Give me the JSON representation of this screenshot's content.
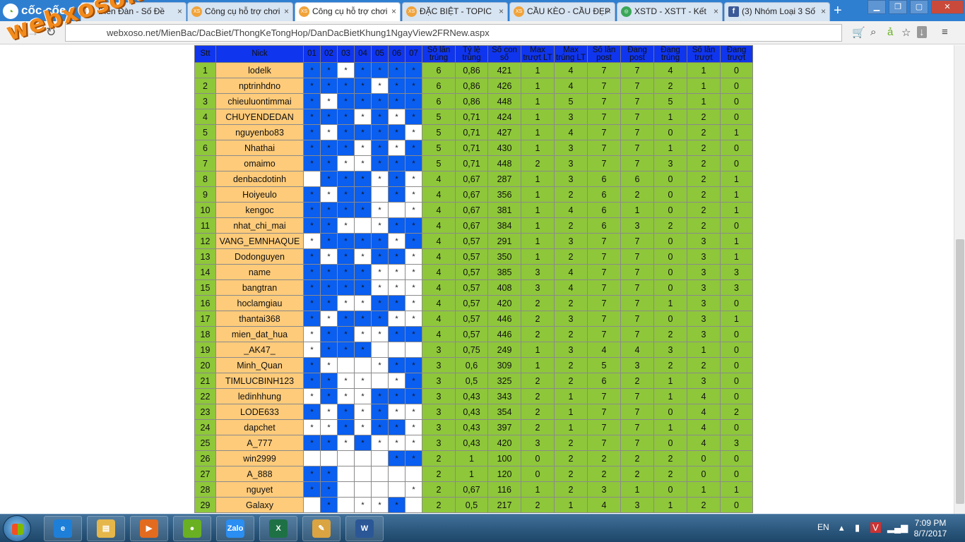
{
  "browser": {
    "brand": "cốc cốc",
    "tabs": [
      {
        "title": "Diễn Đàn - Số Đề",
        "active": false,
        "icon": "page-icon"
      },
      {
        "title": "Công cụ hỗ trợ chơi",
        "active": false,
        "icon": "xs-icon"
      },
      {
        "title": "Công cụ hỗ trợ chơi",
        "active": true,
        "icon": "xs-icon"
      },
      {
        "title": "ĐẶC BIỆT - TOPIC",
        "active": false,
        "icon": "xs-icon"
      },
      {
        "title": "CẦU KÈO - CẦU ĐẸP",
        "active": false,
        "icon": "xs-icon"
      },
      {
        "title": "XSTD - XSTT - Kết",
        "active": false,
        "icon": "chrome-icon"
      },
      {
        "title": "(3) Nhóm Loại 3 Số",
        "active": false,
        "icon": "facebook-icon"
      }
    ],
    "url": "webxoso.net/MienBac/DacBiet/ThongKeTongHop/DanDacBietKhung1NgayView2FRNew.aspx",
    "watermark": "webxoso.net"
  },
  "table": {
    "headers": [
      "Stt",
      "Nick",
      "01",
      "02",
      "03",
      "04",
      "05",
      "06",
      "07",
      "Số lần trúng",
      "Tỷ lệ trúng",
      "Số con số",
      "Max trượt LT",
      "Max trúng LT",
      "Số lần post",
      "Đang post",
      "Đang trúng",
      "Số lần trượt",
      "Đang trượt"
    ],
    "rows": [
      {
        "stt": "1",
        "nick": "lodelk",
        "marks": [
          1,
          1,
          0,
          1,
          1,
          1,
          1
        ],
        "stats": [
          "6",
          "0,86",
          "421",
          "1",
          "4",
          "7",
          "7",
          "4",
          "1",
          "0"
        ]
      },
      {
        "stt": "2",
        "nick": "nptrinhdno",
        "marks": [
          1,
          1,
          1,
          1,
          0,
          1,
          1
        ],
        "stats": [
          "6",
          "0,86",
          "426",
          "1",
          "4",
          "7",
          "7",
          "2",
          "1",
          "0"
        ]
      },
      {
        "stt": "3",
        "nick": "chieuluontimmai",
        "marks": [
          1,
          0,
          1,
          1,
          1,
          1,
          1
        ],
        "stats": [
          "6",
          "0,86",
          "448",
          "1",
          "5",
          "7",
          "7",
          "5",
          "1",
          "0"
        ]
      },
      {
        "stt": "4",
        "nick": "CHUYENDEDAN",
        "marks": [
          1,
          1,
          1,
          0,
          1,
          0,
          1
        ],
        "stats": [
          "5",
          "0,71",
          "424",
          "1",
          "3",
          "7",
          "7",
          "1",
          "2",
          "0"
        ]
      },
      {
        "stt": "5",
        "nick": "nguyenbo83",
        "marks": [
          1,
          0,
          1,
          1,
          1,
          1,
          0
        ],
        "stats": [
          "5",
          "0,71",
          "427",
          "1",
          "4",
          "7",
          "7",
          "0",
          "2",
          "1"
        ]
      },
      {
        "stt": "6",
        "nick": "Nhathai",
        "marks": [
          1,
          1,
          1,
          0,
          1,
          0,
          1
        ],
        "stats": [
          "5",
          "0,71",
          "430",
          "1",
          "3",
          "7",
          "7",
          "1",
          "2",
          "0"
        ]
      },
      {
        "stt": "7",
        "nick": "omaimo",
        "marks": [
          1,
          1,
          0,
          0,
          1,
          1,
          1
        ],
        "stats": [
          "5",
          "0,71",
          "448",
          "2",
          "3",
          "7",
          "7",
          "3",
          "2",
          "0"
        ]
      },
      {
        "stt": "8",
        "nick": "denbacdotinh",
        "marks": [
          -1,
          1,
          1,
          1,
          0,
          1,
          0
        ],
        "stats": [
          "4",
          "0,67",
          "287",
          "1",
          "3",
          "6",
          "6",
          "0",
          "2",
          "1"
        ]
      },
      {
        "stt": "9",
        "nick": "Hoiyeulo",
        "marks": [
          1,
          0,
          1,
          1,
          -1,
          1,
          0
        ],
        "stats": [
          "4",
          "0,67",
          "356",
          "1",
          "2",
          "6",
          "2",
          "0",
          "2",
          "1"
        ]
      },
      {
        "stt": "10",
        "nick": "kengoc",
        "marks": [
          1,
          1,
          1,
          1,
          0,
          -1,
          0
        ],
        "stats": [
          "4",
          "0,67",
          "381",
          "1",
          "4",
          "6",
          "1",
          "0",
          "2",
          "1"
        ]
      },
      {
        "stt": "11",
        "nick": "nhat_chi_mai",
        "marks": [
          1,
          1,
          0,
          -1,
          0,
          1,
          1
        ],
        "stats": [
          "4",
          "0,67",
          "384",
          "1",
          "2",
          "6",
          "3",
          "2",
          "2",
          "0"
        ]
      },
      {
        "stt": "12",
        "nick": "VANG_EMNHAQUE",
        "marks": [
          0,
          1,
          1,
          1,
          1,
          0,
          1
        ],
        "stats": [
          "4",
          "0,57",
          "291",
          "1",
          "3",
          "7",
          "7",
          "0",
          "3",
          "1"
        ]
      },
      {
        "stt": "13",
        "nick": "Dodonguyen",
        "marks": [
          1,
          0,
          1,
          0,
          1,
          1,
          0
        ],
        "stats": [
          "4",
          "0,57",
          "350",
          "1",
          "2",
          "7",
          "7",
          "0",
          "3",
          "1"
        ]
      },
      {
        "stt": "14",
        "nick": "name",
        "marks": [
          1,
          1,
          1,
          1,
          0,
          0,
          0
        ],
        "stats": [
          "4",
          "0,57",
          "385",
          "3",
          "4",
          "7",
          "7",
          "0",
          "3",
          "3"
        ]
      },
      {
        "stt": "15",
        "nick": "bangtran",
        "marks": [
          1,
          1,
          1,
          1,
          0,
          0,
          0
        ],
        "stats": [
          "4",
          "0,57",
          "408",
          "3",
          "4",
          "7",
          "7",
          "0",
          "3",
          "3"
        ]
      },
      {
        "stt": "16",
        "nick": "hoclamgiau",
        "marks": [
          1,
          1,
          0,
          0,
          1,
          1,
          0
        ],
        "stats": [
          "4",
          "0,57",
          "420",
          "2",
          "2",
          "7",
          "7",
          "1",
          "3",
          "0"
        ]
      },
      {
        "stt": "17",
        "nick": "thantai368",
        "marks": [
          1,
          0,
          1,
          1,
          1,
          0,
          0
        ],
        "stats": [
          "4",
          "0,57",
          "446",
          "2",
          "3",
          "7",
          "7",
          "0",
          "3",
          "1"
        ]
      },
      {
        "stt": "18",
        "nick": "mien_dat_hua",
        "marks": [
          0,
          1,
          1,
          0,
          0,
          1,
          1
        ],
        "stats": [
          "4",
          "0,57",
          "446",
          "2",
          "2",
          "7",
          "7",
          "2",
          "3",
          "0"
        ]
      },
      {
        "stt": "19",
        "nick": "_AK47_",
        "marks": [
          0,
          1,
          1,
          1,
          -1,
          -1,
          -1
        ],
        "stats": [
          "3",
          "0,75",
          "249",
          "1",
          "3",
          "4",
          "4",
          "3",
          "1",
          "0"
        ]
      },
      {
        "stt": "20",
        "nick": "Minh_Quan",
        "marks": [
          1,
          0,
          -1,
          -1,
          0,
          1,
          1
        ],
        "stats": [
          "3",
          "0,6",
          "309",
          "1",
          "2",
          "5",
          "3",
          "2",
          "2",
          "0"
        ]
      },
      {
        "stt": "21",
        "nick": "TIMLUCBINH123",
        "marks": [
          1,
          1,
          0,
          0,
          -1,
          0,
          1
        ],
        "stats": [
          "3",
          "0,5",
          "325",
          "2",
          "2",
          "6",
          "2",
          "1",
          "3",
          "0"
        ]
      },
      {
        "stt": "22",
        "nick": "ledinhhung",
        "marks": [
          0,
          1,
          0,
          0,
          1,
          1,
          1
        ],
        "stats": [
          "3",
          "0,43",
          "343",
          "2",
          "1",
          "7",
          "7",
          "1",
          "4",
          "0"
        ]
      },
      {
        "stt": "23",
        "nick": "LODE633",
        "marks": [
          1,
          0,
          1,
          0,
          1,
          0,
          0
        ],
        "stats": [
          "3",
          "0,43",
          "354",
          "2",
          "1",
          "7",
          "7",
          "0",
          "4",
          "2"
        ]
      },
      {
        "stt": "24",
        "nick": "dapchet",
        "marks": [
          0,
          0,
          1,
          0,
          1,
          1,
          0
        ],
        "stats": [
          "3",
          "0,43",
          "397",
          "2",
          "1",
          "7",
          "7",
          "1",
          "4",
          "0"
        ]
      },
      {
        "stt": "25",
        "nick": "A_777",
        "marks": [
          1,
          1,
          0,
          1,
          0,
          0,
          0
        ],
        "stats": [
          "3",
          "0,43",
          "420",
          "3",
          "2",
          "7",
          "7",
          "0",
          "4",
          "3"
        ]
      },
      {
        "stt": "26",
        "nick": "win2999",
        "marks": [
          -1,
          -1,
          -1,
          -1,
          -1,
          1,
          1
        ],
        "stats": [
          "2",
          "1",
          "100",
          "0",
          "2",
          "2",
          "2",
          "2",
          "0",
          "0"
        ]
      },
      {
        "stt": "27",
        "nick": "A_888",
        "marks": [
          1,
          1,
          -1,
          -1,
          -1,
          -1,
          -1
        ],
        "stats": [
          "2",
          "1",
          "120",
          "0",
          "2",
          "2",
          "2",
          "2",
          "0",
          "0"
        ]
      },
      {
        "stt": "28",
        "nick": "nguyet",
        "marks": [
          1,
          1,
          -1,
          -1,
          -1,
          -1,
          0
        ],
        "stats": [
          "2",
          "0,67",
          "116",
          "1",
          "2",
          "3",
          "1",
          "0",
          "1",
          "1"
        ]
      },
      {
        "stt": "29",
        "nick": "Galaxy",
        "marks": [
          -1,
          1,
          -1,
          0,
          0,
          1,
          -1
        ],
        "stats": [
          "2",
          "0,5",
          "217",
          "2",
          "1",
          "4",
          "3",
          "1",
          "2",
          "0"
        ]
      }
    ]
  },
  "taskbar": {
    "apps": [
      {
        "name": "internet-explorer-icon",
        "color": "#1e7fd8",
        "label": "e"
      },
      {
        "name": "file-explorer-icon",
        "color": "#e5b64a",
        "label": "▤"
      },
      {
        "name": "media-player-icon",
        "color": "#e36b1f",
        "label": "▶"
      },
      {
        "name": "coccoc-icon",
        "color": "#6ab023",
        "label": "●"
      },
      {
        "name": "zalo-icon",
        "color": "#2a8ef2",
        "label": "Zalo"
      },
      {
        "name": "excel-icon",
        "color": "#1e7145",
        "label": "X"
      },
      {
        "name": "paint-icon",
        "color": "#d9a441",
        "label": "✎"
      },
      {
        "name": "word-icon",
        "color": "#2b5797",
        "label": "W"
      }
    ],
    "lang": "EN",
    "time": "7:09 PM",
    "date": "8/7/2017"
  },
  "colors": {
    "header_bg": "#0f35ee",
    "marked": "#0a5ef0",
    "stat_bg": "#8ec73a",
    "nick_bg": "#fecb7a"
  }
}
